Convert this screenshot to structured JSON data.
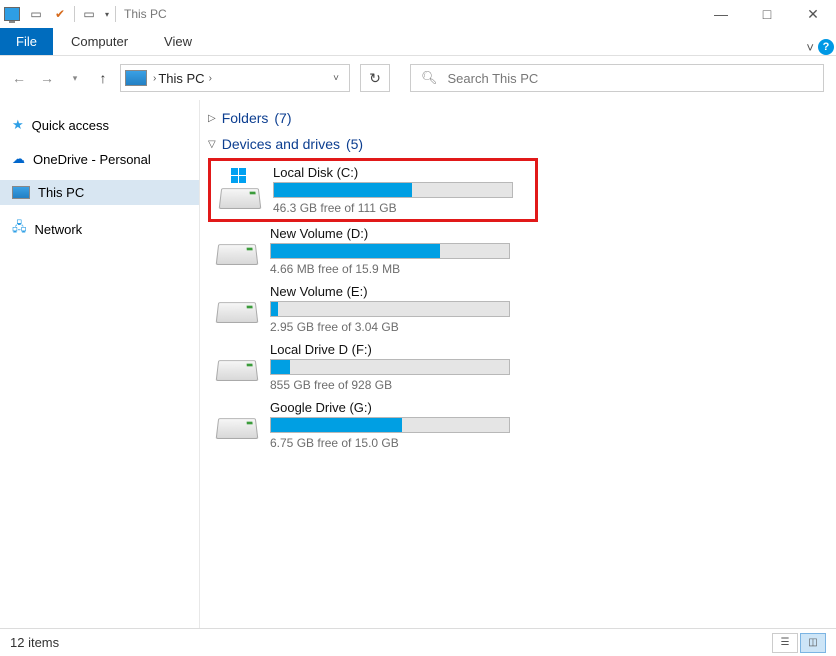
{
  "window": {
    "title": "This PC",
    "controls": {
      "minimize": "—",
      "maximize": "□",
      "close": "✕"
    }
  },
  "ribbon": {
    "file": "File",
    "tabs": [
      "Computer",
      "View"
    ],
    "collapse_caret": "˅"
  },
  "nav": {
    "breadcrumb": "This PC",
    "refresh_glyph": "↻"
  },
  "search": {
    "placeholder": "Search This PC"
  },
  "sidebar": {
    "items": [
      {
        "label": "Quick access",
        "icon": "star"
      },
      {
        "label": "OneDrive - Personal",
        "icon": "cloud"
      },
      {
        "label": "This PC",
        "icon": "pc",
        "selected": true
      },
      {
        "label": "Network",
        "icon": "net"
      }
    ]
  },
  "groups": {
    "folders": {
      "label": "Folders",
      "count": "(7)"
    },
    "devices": {
      "label": "Devices and drives",
      "count": "(5)"
    }
  },
  "drives": [
    {
      "name": "Local Disk (C:)",
      "free_text": "46.3 GB free of 111 GB",
      "fill_pct": 58,
      "os": true,
      "highlight": true
    },
    {
      "name": "New Volume (D:)",
      "free_text": "4.66 MB free of 15.9 MB",
      "fill_pct": 71,
      "os": false,
      "highlight": false
    },
    {
      "name": "New Volume (E:)",
      "free_text": "2.95 GB free of 3.04 GB",
      "fill_pct": 3,
      "os": false,
      "highlight": false
    },
    {
      "name": "Local Drive D (F:)",
      "free_text": "855 GB free of 928 GB",
      "fill_pct": 8,
      "os": false,
      "highlight": false
    },
    {
      "name": "Google Drive (G:)",
      "free_text": "6.75 GB free of 15.0 GB",
      "fill_pct": 55,
      "os": false,
      "highlight": false
    }
  ],
  "statusbar": {
    "items_text": "12 items"
  }
}
